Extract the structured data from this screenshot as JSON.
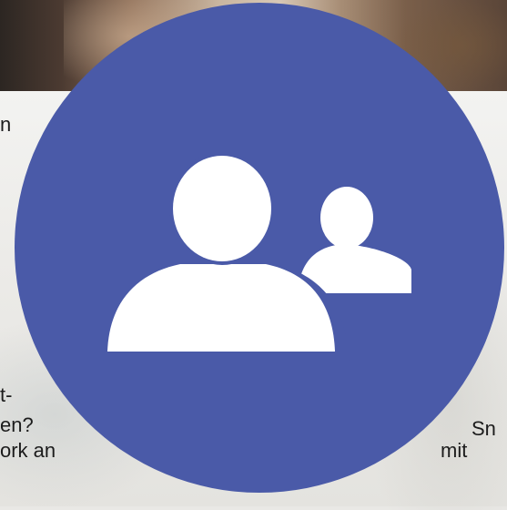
{
  "background_fragments": {
    "left_top": "n",
    "left_dash": "t-",
    "left_q": "en?",
    "left_work": "ork an",
    "right_sm": "Sn",
    "right_mit": "mit"
  },
  "icon": {
    "name": "people-icon"
  },
  "colors": {
    "circle": "#4a5aa8",
    "icon": "#ffffff"
  }
}
